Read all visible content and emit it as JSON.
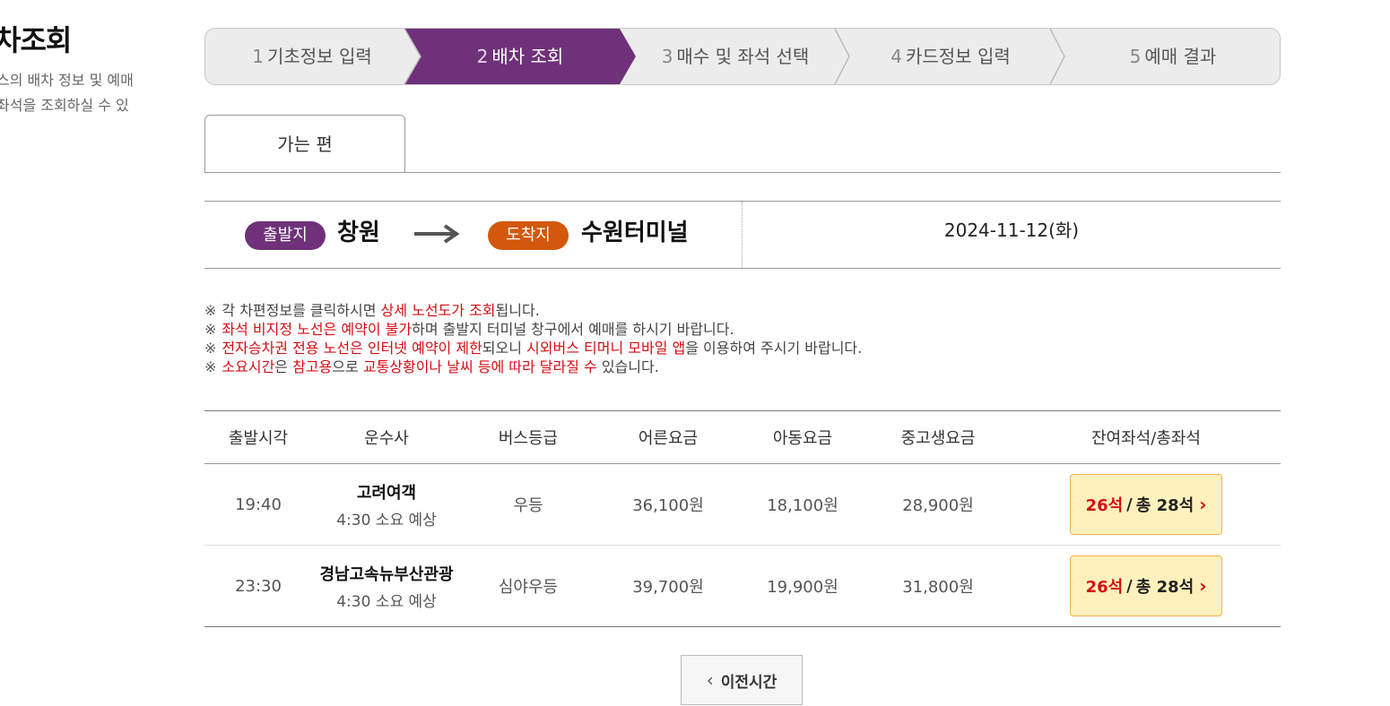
{
  "side": {
    "title": "차조회",
    "desc_lines": [
      "스의 배차 정보 및 예매",
      "좌석을 조회하실 수 있"
    ]
  },
  "steps": [
    {
      "num": "1",
      "label": "기초정보 입력",
      "active": false
    },
    {
      "num": "2",
      "label": "배차 조회",
      "active": true
    },
    {
      "num": "3",
      "label": "매수 및 좌석 선택",
      "active": false
    },
    {
      "num": "4",
      "label": "카드정보 입력",
      "active": false
    },
    {
      "num": "5",
      "label": "예매 결과",
      "active": false
    }
  ],
  "tab": {
    "label": "가는 편"
  },
  "route": {
    "departure_badge": "출발지",
    "departure": "창원",
    "arrival_badge": "도착지",
    "arrival": "수원터미널",
    "date": "2024-11-12(화)",
    "arrow_icon": "arrow-right-icon"
  },
  "notices": {
    "mark": "※",
    "line1": {
      "a": "각 차편정보를 클릭하시면 ",
      "b": "상세 노선도가 조회",
      "c": "됩니다."
    },
    "line2": {
      "a": "좌석 비지정 노선은 예약이 불가",
      "b": "하며 출발지 터미널 창구에서 예매를 하시기 바랍니다."
    },
    "line3": {
      "a": "전자승차권 전용 노선은 인터넷 예약이 제한",
      "b": "되오니 ",
      "c": "시외버스 티머니 모바일 앱",
      "d": "을 이용하여 주시기 바랍니다."
    },
    "line4": {
      "a": "소요시간",
      "b": "은 ",
      "c": "참고용",
      "d": "으로 ",
      "e": "교통상황이나 날씨 등에 따라 달라질 수",
      "f": " 있습니다."
    }
  },
  "table": {
    "headers": [
      "출발시각",
      "운수사",
      "버스등급",
      "어른요금",
      "아동요금",
      "중고생요금",
      "잔여좌석/총좌석"
    ],
    "rows": [
      {
        "time": "19:40",
        "company": "고려여객",
        "duration": "4:30 소요 예상",
        "grade": "우등",
        "adult": "36,100원",
        "child": "18,100원",
        "student": "28,900원",
        "remain": "26석",
        "sep": "/",
        "total": "총 28석"
      },
      {
        "time": "23:30",
        "company": "경남고속뉴부산관광",
        "duration": "4:30 소요 예상",
        "grade": "심야우등",
        "adult": "39,700원",
        "child": "19,900원",
        "student": "31,800원",
        "remain": "26석",
        "sep": "/",
        "total": "총 28석"
      }
    ]
  },
  "prev_button": {
    "label": "이전시간",
    "icon": "chevron-left-icon"
  },
  "colors": {
    "active_step": "#6f3179",
    "arrival_badge": "#d2580b",
    "highlight": "#d40e14",
    "seat_bg": "#fff1bd"
  }
}
